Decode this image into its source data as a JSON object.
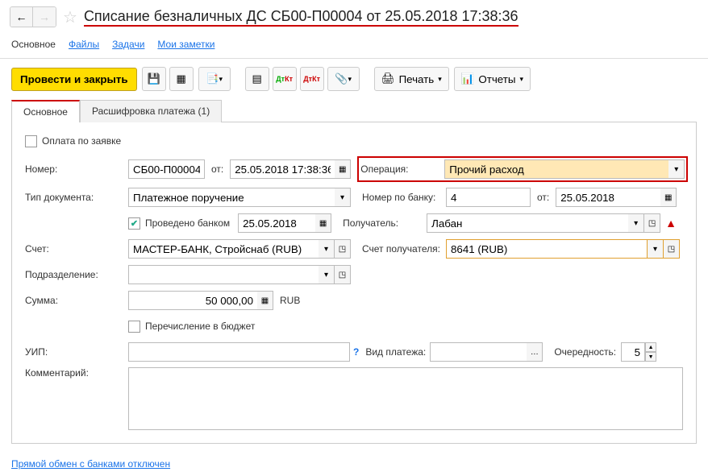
{
  "header": {
    "title": "Списание безналичных ДС СБ00-П00004 от 25.05.2018 17:38:36"
  },
  "subnav": {
    "main": "Основное",
    "files": "Файлы",
    "tasks": "Задачи",
    "notes": "Мои заметки"
  },
  "toolbar": {
    "post_close": "Провести и закрыть",
    "print": "Печать",
    "reports": "Отчеты"
  },
  "tabs": {
    "main": "Основное",
    "detail": "Расшифровка платежа (1)"
  },
  "form": {
    "pay_request_label": "Оплата по заявке",
    "number_label": "Номер:",
    "number_value": "СБ00-П00004",
    "from_label": "от:",
    "date_value": "25.05.2018 17:38:36",
    "operation_label": "Операция:",
    "operation_value": "Прочий расход",
    "doctype_label": "Тип документа:",
    "doctype_value": "Платежное поручение",
    "banknum_label": "Номер по банку:",
    "banknum_value": "4",
    "bankdate_value": "25.05.2018",
    "processed_bank": "Проведено банком",
    "processed_date": "25.05.2018",
    "recipient_label": "Получатель:",
    "recipient_value": "Лабан",
    "account_label": "Счет:",
    "account_value": "МАСТЕР-БАНК, Стройснаб (RUB)",
    "recip_account_label": "Счет получателя:",
    "recip_account_value": "8641 (RUB)",
    "division_label": "Подразделение:",
    "sum_label": "Сумма:",
    "sum_value": "50 000,00",
    "currency": "RUB",
    "budget_label": "Перечисление в бюджет",
    "uip_label": "УИП:",
    "payment_type_label": "Вид платежа:",
    "priority_label": "Очередность:",
    "priority_value": "5",
    "comment_label": "Комментарий:"
  },
  "footer": {
    "link": "Прямой обмен с банками отключен"
  }
}
